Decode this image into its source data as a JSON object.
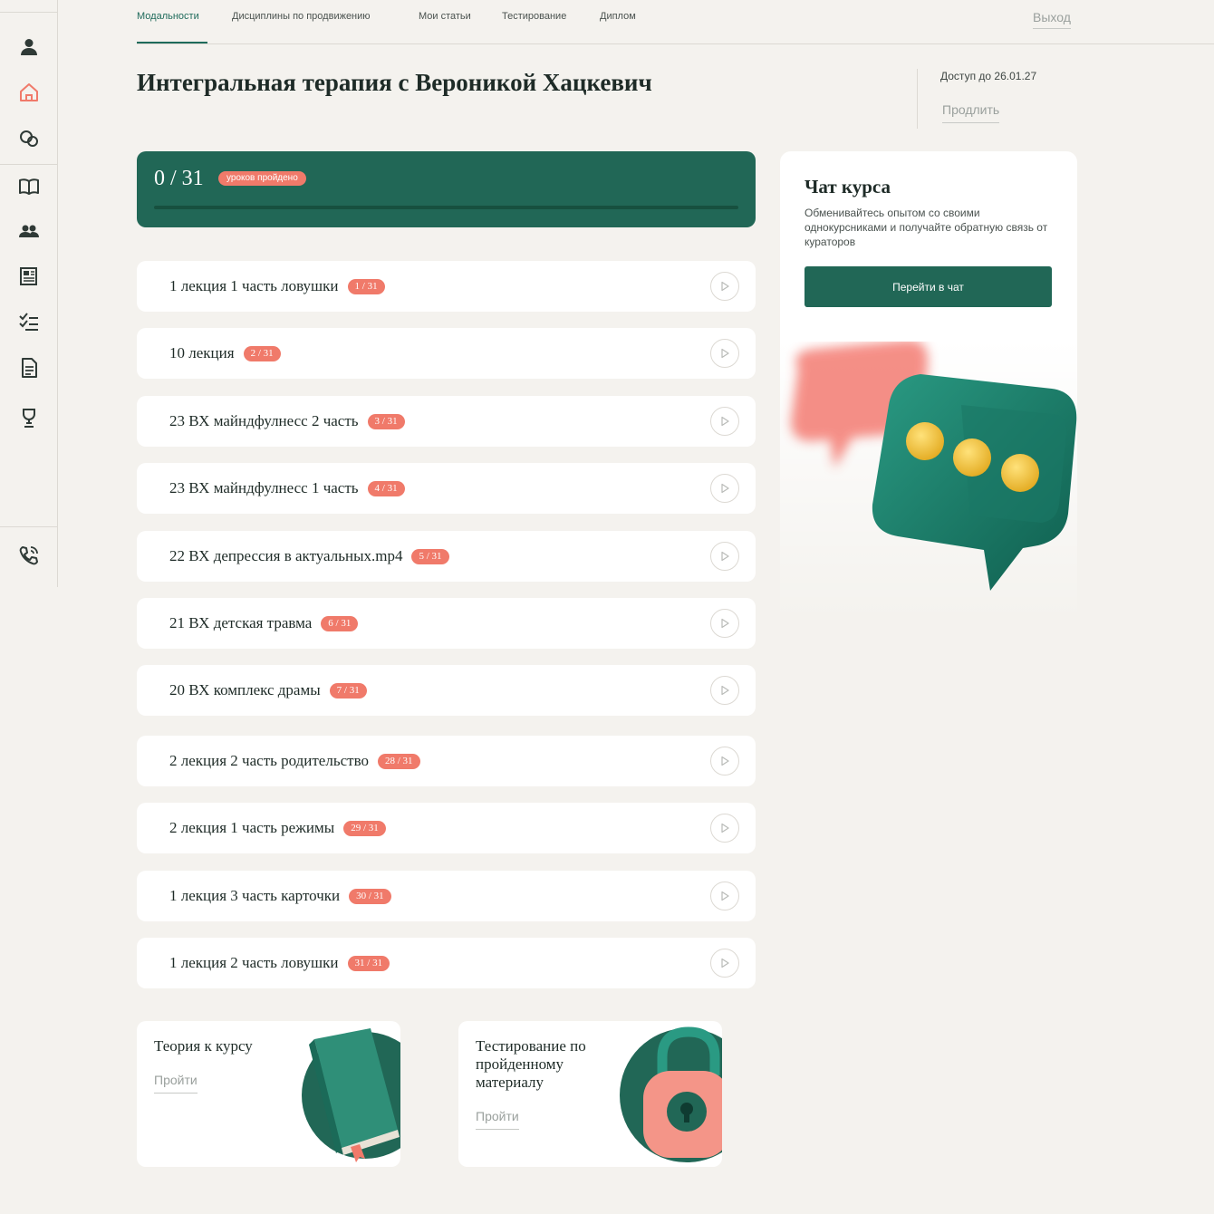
{
  "nav": {
    "tabs": [
      {
        "label": "Модальности",
        "active": true
      },
      {
        "label": "Дисциплины по продвижению",
        "active": false
      },
      {
        "label": "Мои статьи",
        "active": false
      },
      {
        "label": "Тестирование",
        "active": false
      },
      {
        "label": "Диплом",
        "active": false
      }
    ],
    "logout": "Выход"
  },
  "sidebar": {
    "icons": [
      "user-icon",
      "home-icon",
      "chat-icon",
      "book-icon",
      "people-icon",
      "news-icon",
      "checklist-icon",
      "document-icon",
      "trophy-icon",
      "phone-icon"
    ],
    "active": "home-icon"
  },
  "course": {
    "title": "Интегральная терапия с Вероникой Хацкевич",
    "access": "Доступ до 26.01.27",
    "extend": "Продлить"
  },
  "progress": {
    "count": "0 / 31",
    "badge": "уроков пройдено",
    "fraction": 0
  },
  "lessons": [
    {
      "title": "1 лекция 1 часть ловушки",
      "badge": "1 / 31"
    },
    {
      "title": "10 лекция",
      "badge": "2 / 31"
    },
    {
      "title": "23 ВХ майндфулнесс 2 часть",
      "badge": "3 / 31"
    },
    {
      "title": "23 ВХ майндфулнесс 1 часть",
      "badge": "4 / 31"
    },
    {
      "title": "22 ВХ депрессия в актуальных.mp4",
      "badge": "5 / 31"
    },
    {
      "title": "21 ВХ детская травма",
      "badge": "6 / 31"
    },
    {
      "title": "20 ВХ комплекс драмы",
      "badge": "7 / 31"
    },
    {
      "title": "2 лекция 2 часть родительство",
      "badge": "28 / 31"
    },
    {
      "title": "2 лекция 1 часть режимы",
      "badge": "29 / 31"
    },
    {
      "title": "1 лекция 3 часть карточки",
      "badge": "30 / 31"
    },
    {
      "title": "1 лекция 2 часть ловушки",
      "badge": "31 / 31"
    }
  ],
  "chat": {
    "title": "Чат курса",
    "description": "Обменивайтесь опытом со своими однокурсниками и получайте обратную связь от кураторов",
    "button": "Перейти в чат"
  },
  "theory": {
    "title": "Теория к курсу",
    "link": "Пройти"
  },
  "testing": {
    "title": "Тестирование по пройденному материалу",
    "link": "Пройти"
  },
  "colors": {
    "primary": "#216756",
    "accent": "#f07a6a",
    "background": "#f4f2ee"
  }
}
